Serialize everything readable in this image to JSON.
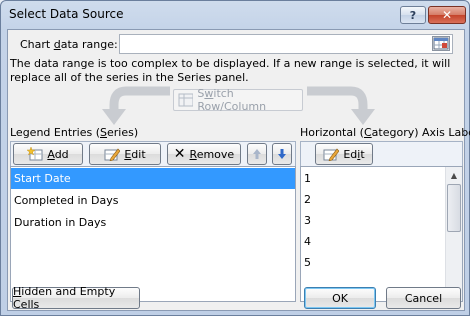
{
  "window": {
    "title": "Select Data Source",
    "help_glyph": "?",
    "close_glyph": "✕"
  },
  "range": {
    "label_pre": "Chart ",
    "label_u": "d",
    "label_post": "ata range:",
    "value": ""
  },
  "message": "The data range is too complex to be displayed. If a new range is selected, it will replace all of the series in the Series panel.",
  "switch_button": {
    "pre": "S",
    "u": "w",
    "post": "itch Row/Column"
  },
  "legend_panel": {
    "label_pre": "Legend Entries (",
    "label_u": "S",
    "label_post": "eries)",
    "add_label_u": "A",
    "add_label_post": "dd",
    "edit_label_u": "E",
    "edit_label_post": "dit",
    "remove_label_u": "R",
    "remove_label_post": "emove",
    "series": [
      {
        "name": "Start Date",
        "selected": true
      },
      {
        "name": "Completed in Days",
        "selected": false
      },
      {
        "name": "Duration in Days",
        "selected": false
      }
    ]
  },
  "axis_panel": {
    "label_pre": "Horizontal (",
    "label_u": "C",
    "label_post": "ategory) Axis Labels",
    "edit_label_pre": "Ed",
    "edit_label_u": "i",
    "edit_label_post": "t",
    "labels": [
      "1",
      "2",
      "3",
      "4",
      "5"
    ]
  },
  "footer": {
    "hidden_pre": "",
    "hidden_u": "H",
    "hidden_post": "idden and Empty Cells",
    "ok": "OK",
    "cancel": "Cancel"
  },
  "icons": {
    "add": "add-series-icon",
    "edit": "edit-pencil-icon",
    "remove": "remove-x-icon",
    "up": "move-up-icon",
    "down": "move-down-icon",
    "range": "range-selector-icon",
    "switch": "switch-row-column-icon"
  },
  "colors": {
    "selection": "#3399ff",
    "title_bar": "#c4d3e8",
    "close_button": "#c4432a"
  }
}
